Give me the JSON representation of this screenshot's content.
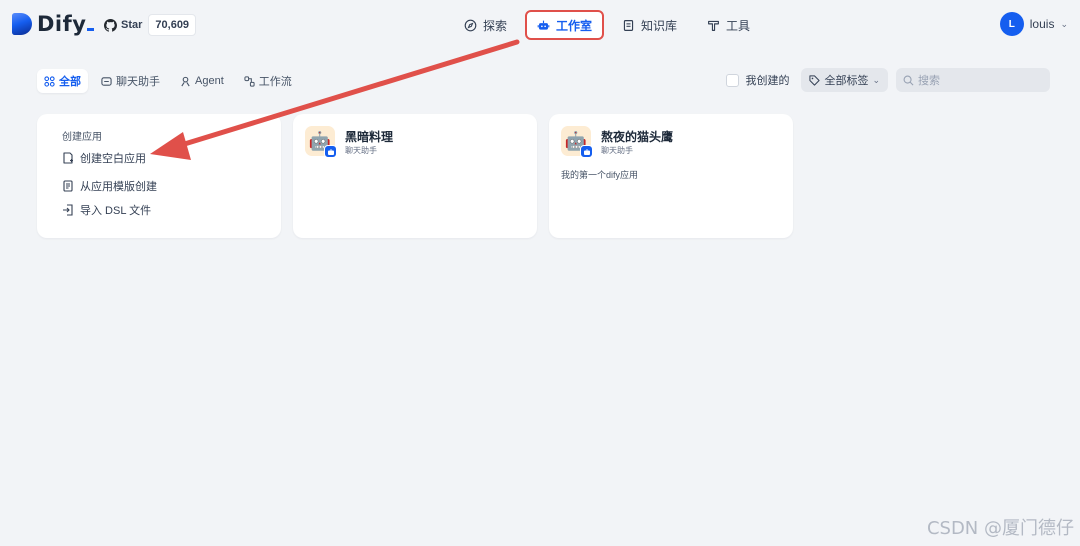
{
  "brand": {
    "name": "Dify",
    "accent": "#155eef"
  },
  "github": {
    "label": "Star",
    "count": "70,609",
    "icon": "github-icon"
  },
  "nav": {
    "items": [
      {
        "label": "探索",
        "icon": "compass-icon",
        "active": false
      },
      {
        "label": "工作室",
        "icon": "robot-icon",
        "active": true
      },
      {
        "label": "知识库",
        "icon": "book-icon",
        "active": false
      },
      {
        "label": "工具",
        "icon": "hammer-icon",
        "active": false
      }
    ]
  },
  "user": {
    "initial": "L",
    "name": "louis"
  },
  "tabs": [
    {
      "label": "全部",
      "icon": "grid-icon",
      "active": true
    },
    {
      "label": "聊天助手",
      "icon": "chat-icon",
      "active": false
    },
    {
      "label": "Agent",
      "icon": "agent-icon",
      "active": false
    },
    {
      "label": "工作流",
      "icon": "workflow-icon",
      "active": false
    }
  ],
  "filters": {
    "mine_label": "我创建的",
    "mine_checked": false,
    "tag_label": "全部标签",
    "search_placeholder": "搜索"
  },
  "create": {
    "title": "创建应用",
    "items": [
      {
        "label": "创建空白应用",
        "icon": "file-plus-icon"
      },
      {
        "label": "从应用模版创建",
        "icon": "template-icon"
      },
      {
        "label": "导入 DSL 文件",
        "icon": "import-icon"
      }
    ]
  },
  "apps": [
    {
      "name": "黑暗料理",
      "type": "聊天助手",
      "description": "",
      "icon": "robot-emoji"
    },
    {
      "name": "熬夜的猫头鹰",
      "type": "聊天助手",
      "description": "我的第一个dify应用",
      "icon": "robot-emoji"
    }
  ],
  "annotation": {
    "color": "#e0504a"
  },
  "watermark": "CSDN @厦门德仔"
}
